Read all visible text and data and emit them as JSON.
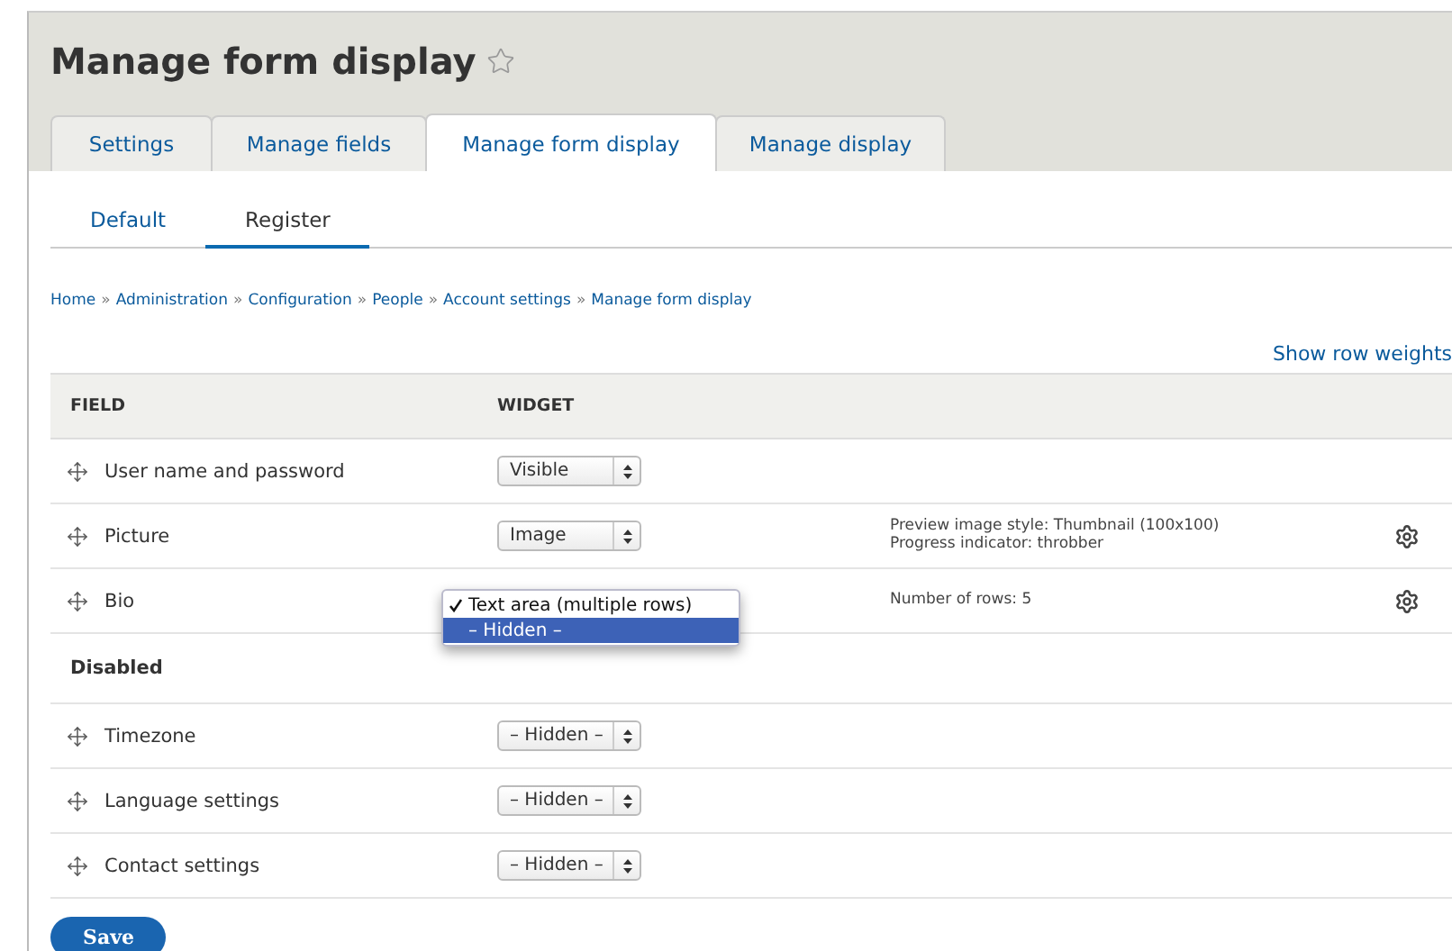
{
  "page_title": "Manage form display",
  "tabs": [
    {
      "label": "Settings",
      "selected": false
    },
    {
      "label": "Manage fields",
      "selected": false
    },
    {
      "label": "Manage form display",
      "selected": true
    },
    {
      "label": "Manage display",
      "selected": false
    }
  ],
  "secondary_tabs": [
    {
      "label": "Default",
      "selected": false
    },
    {
      "label": "Register",
      "selected": true
    }
  ],
  "breadcrumb": [
    "Home",
    "Administration",
    "Configuration",
    "People",
    "Account settings",
    "Manage form display"
  ],
  "breadcrumb_separator": "»",
  "show_row_weights": "Show row weights",
  "table": {
    "columns": [
      "FIELD",
      "WIDGET"
    ],
    "rows": [
      {
        "kind": "field",
        "label": "User name and password",
        "widget": {
          "kind": "select",
          "value": "Visible"
        }
      },
      {
        "kind": "field",
        "label": "Picture",
        "widget": {
          "kind": "select",
          "value": "Image"
        },
        "summary": [
          "Preview image style: Thumbnail (100x100)",
          "Progress indicator: throbber"
        ],
        "settings": true
      },
      {
        "kind": "field",
        "label": "Bio",
        "widget": {
          "kind": "open_menu",
          "options": [
            {
              "label": "Text area (multiple rows)",
              "checked": true,
              "highlighted": false
            },
            {
              "label": "– Hidden –",
              "checked": false,
              "highlighted": true
            }
          ]
        },
        "summary": [
          "Number of rows: 5"
        ],
        "settings": true
      },
      {
        "kind": "region",
        "label": "Disabled"
      },
      {
        "kind": "field",
        "label": "Timezone",
        "widget": {
          "kind": "select",
          "value": "– Hidden –"
        }
      },
      {
        "kind": "field",
        "label": "Language settings",
        "widget": {
          "kind": "select",
          "value": "– Hidden –"
        }
      },
      {
        "kind": "field",
        "label": "Contact settings",
        "widget": {
          "kind": "select",
          "value": "– Hidden –"
        }
      }
    ]
  },
  "save_button": "Save"
}
